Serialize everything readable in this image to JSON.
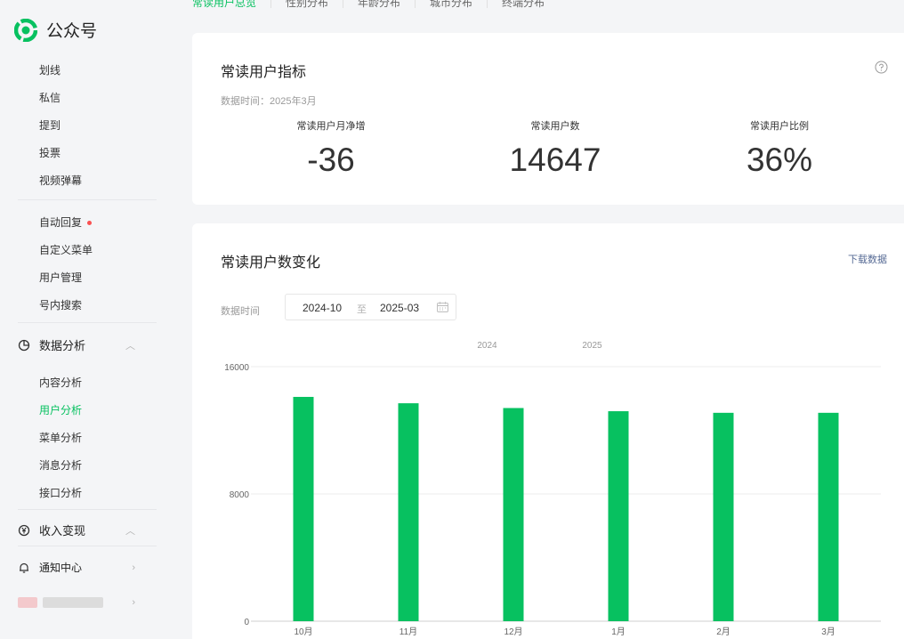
{
  "app": {
    "name": "公众号"
  },
  "tabs": [
    {
      "label": "常读用户总览",
      "active": true
    },
    {
      "label": "性别分布"
    },
    {
      "label": "年龄分布"
    },
    {
      "label": "城市分布"
    },
    {
      "label": "终端分布"
    }
  ],
  "sidebar": {
    "items_a": [
      "划线",
      "私信",
      "提到",
      "投票",
      "视频弹幕"
    ],
    "items_b": [
      "自动回复",
      "自定义菜单",
      "用户管理",
      "号内搜索"
    ],
    "analytics": {
      "label": "数据分析",
      "items": [
        "内容分析",
        "用户分析",
        "菜单分析",
        "消息分析",
        "接口分析"
      ],
      "active_item": "用户分析"
    },
    "revenue": {
      "label": "收入变现"
    },
    "notifications": {
      "label": "通知中心"
    }
  },
  "indicator_card": {
    "title": "常读用户指标",
    "data_time": "数据时间：2025年3月",
    "metrics": [
      {
        "label": "常读用户月净增",
        "value": "-36"
      },
      {
        "label": "常读用户数",
        "value": "14647"
      },
      {
        "label": "常读用户比例",
        "value": "36%"
      }
    ]
  },
  "change_card": {
    "title": "常读用户数变化",
    "download_label": "下载数据",
    "date_label": "数据时间",
    "date_from": "2024-10",
    "date_sep": "至",
    "date_to": "2025-03"
  },
  "chart_data": {
    "type": "bar",
    "categories": [
      "10月",
      "11月",
      "12月",
      "1月",
      "2月",
      "3月"
    ],
    "year_labels": [
      "2024",
      "2025"
    ],
    "values": [
      14100,
      13700,
      13400,
      13200,
      13100,
      13100
    ],
    "yticks": [
      0,
      8000,
      16000
    ],
    "ylim": [
      0,
      16000
    ],
    "grid": true,
    "colors": {
      "bar": "#07c160"
    }
  },
  "colors": {
    "accent": "#07c160",
    "link": "#576b95"
  }
}
